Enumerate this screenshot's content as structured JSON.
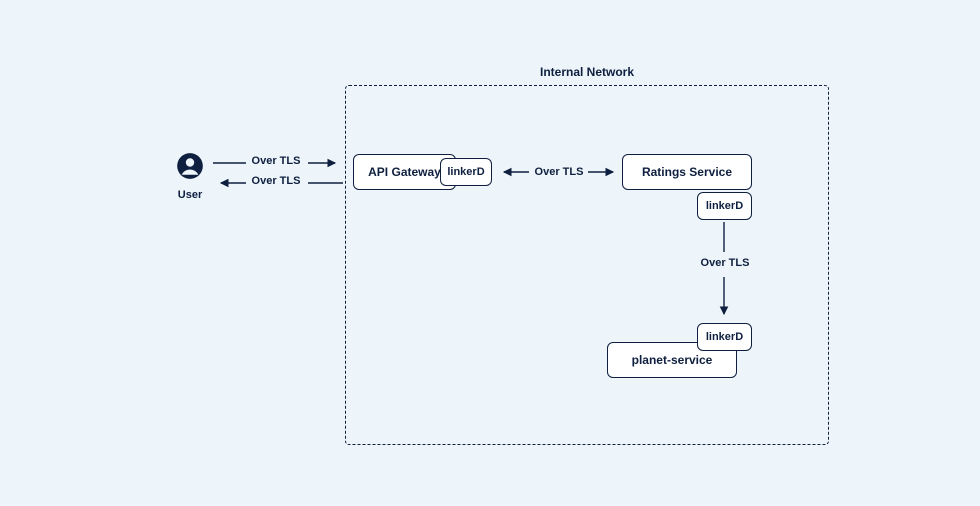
{
  "user": {
    "label": "User"
  },
  "network": {
    "title": "Internal Network"
  },
  "nodes": {
    "gateway": {
      "label": "API Gateway",
      "sidecar": "linkerD"
    },
    "ratings": {
      "label": "Ratings Service",
      "sidecar": "linkerD"
    },
    "planet": {
      "label": "planet-service",
      "sidecar": "linkerD"
    }
  },
  "edges": {
    "user_to_gw": "Over TLS",
    "gw_to_user": "Over TLS",
    "gw_ratings": "Over TLS",
    "ratings_planet": "Over TLS"
  }
}
